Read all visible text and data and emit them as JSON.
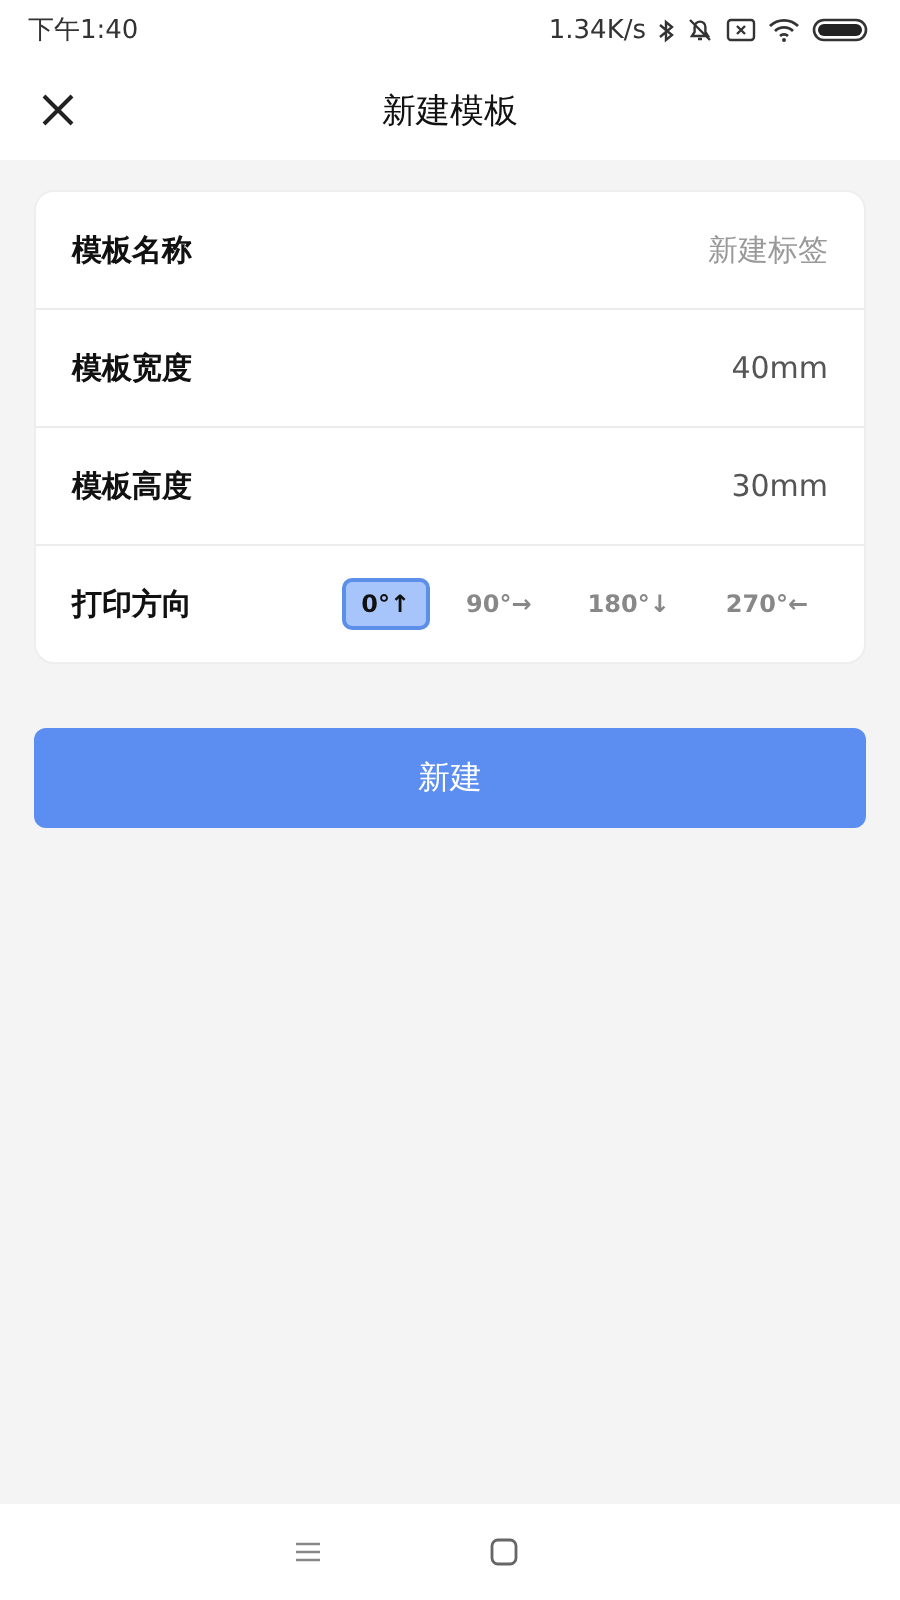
{
  "status_bar": {
    "time": "下午1:40",
    "speed": "1.34K/s"
  },
  "header": {
    "title": "新建模板"
  },
  "fields": [
    {
      "kind": "input",
      "label": "模板名称",
      "placeholder": "新建标签"
    },
    {
      "kind": "value",
      "label": "模板宽度",
      "value": "40mm"
    },
    {
      "kind": "value",
      "label": "模板高度",
      "value": "30mm"
    },
    {
      "kind": "options",
      "label": "打印方向",
      "options": [
        {
          "label": "0°↑",
          "selected": true
        },
        {
          "label": "90°→",
          "selected": false
        },
        {
          "label": "180°↓",
          "selected": false
        },
        {
          "label": "270°←",
          "selected": false
        }
      ]
    }
  ],
  "submit": {
    "label": "新建"
  }
}
